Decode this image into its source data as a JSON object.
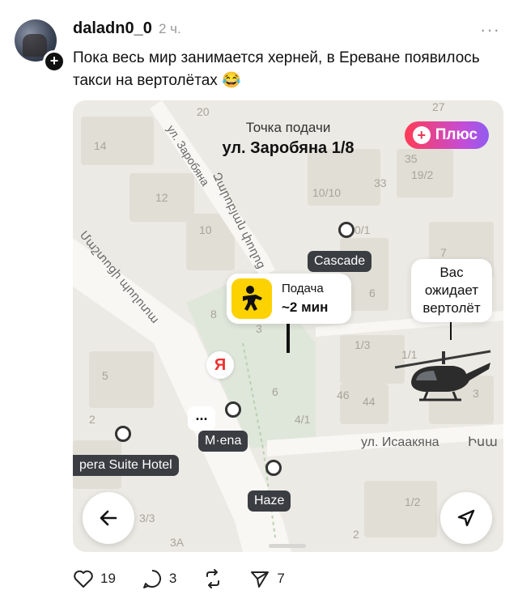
{
  "post": {
    "username": "daladn0_0",
    "time": "2 ч.",
    "more": "···",
    "text": "Пока весь мир занимается херней, в Ереване появилось такси на вертолётах 😂"
  },
  "map": {
    "pickup_header": "Точка подачи",
    "pickup_address": "ул. Заробяна 1/8",
    "plus_label": "Плюс",
    "pickup_label": "Подача",
    "pickup_eta": "~2 мин",
    "heli_message": "Вас ожидает вертолёт",
    "yandex_logo": "Я",
    "dots": "...",
    "pois": [
      "Cascade",
      "M·ena",
      "Haze",
      "pera Suite Hotel"
    ],
    "streets": {
      "zarobyan_ru": "ул. Заробяна",
      "zarobyan_am": "Զարոբյան փողոց",
      "isaakyan_ru": "ул. Исаакяна",
      "isaakyan_am": "Իսա",
      "mashtots_am": "Մաշտոցի պողոտա"
    },
    "numbers": [
      "20",
      "14",
      "12",
      "10",
      "8",
      "5",
      "2",
      "3/3",
      "3А",
      "27",
      "35",
      "33",
      "19/2",
      "10/10",
      "0/1",
      "7",
      "6",
      "1/3",
      "1/1",
      "46",
      "44",
      "4/1",
      "6",
      "3",
      "1/2",
      "2",
      "2"
    ]
  },
  "actions": {
    "likes": "19",
    "comments": "3",
    "shares": "7"
  },
  "colors": {
    "plus_gradient_start": "#ff3b56",
    "plus_gradient_end": "#8f5cf0",
    "pickup_yellow": "#fcd200",
    "map_bg": "#eceae4"
  },
  "icons": [
    "heart-icon",
    "comment-icon",
    "repost-icon",
    "send-icon",
    "back-arrow-icon",
    "navigation-icon",
    "helicopter-icon",
    "person-icon"
  ]
}
